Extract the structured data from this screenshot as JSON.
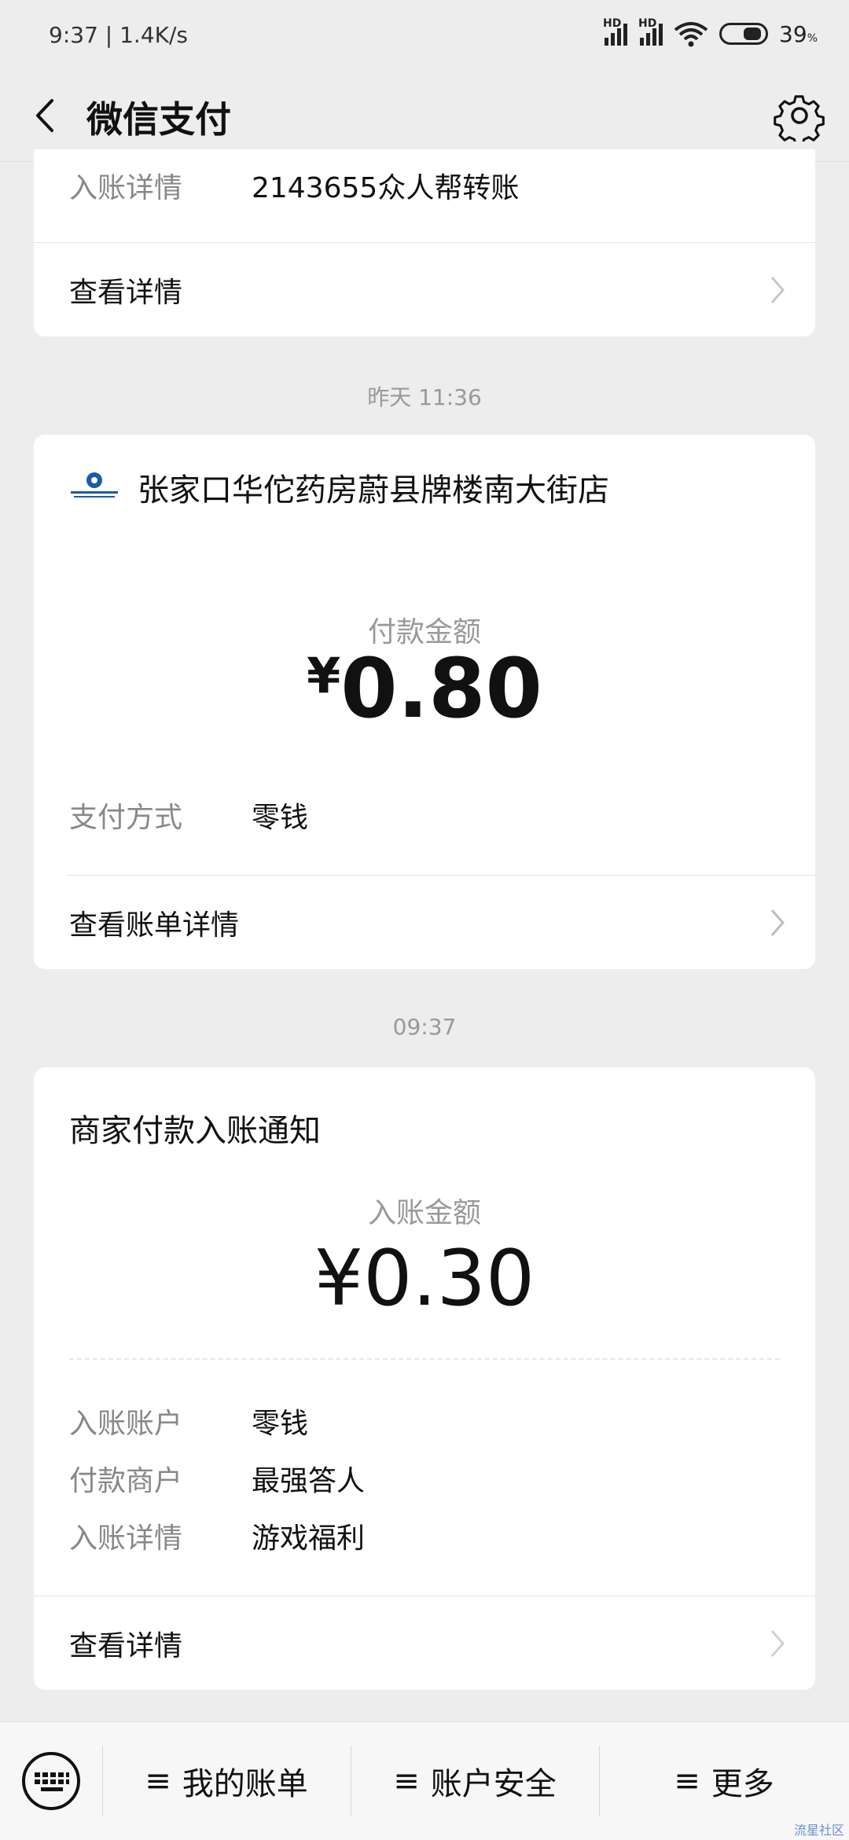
{
  "status": {
    "time": "9:37 | 1.4K/s",
    "network1": "HD",
    "network2": "HD",
    "battery": "39",
    "battery_unit": "%"
  },
  "nav": {
    "title": "微信支付"
  },
  "card1": {
    "label": "入账详情",
    "value": "2143655众人帮转账",
    "link": "查看详情"
  },
  "timestamp1": "昨天 11:36",
  "card2": {
    "merchant": "张家口华佗药房蔚县牌楼南大街店",
    "amount_label": "付款金额",
    "currency": "¥",
    "amount": "0.80",
    "pay_method_label": "支付方式",
    "pay_method_value": "零钱",
    "link": "查看账单详情"
  },
  "timestamp2": "09:37",
  "card3": {
    "title": "商家付款入账通知",
    "amount_label": "入账金额",
    "amount": "¥0.30",
    "rows": [
      {
        "label": "入账账户",
        "value": "零钱"
      },
      {
        "label": "付款商户",
        "value": "最强答人"
      },
      {
        "label": "入账详情",
        "value": "游戏福利"
      }
    ],
    "link": "查看详情"
  },
  "bottom": {
    "items": [
      "我的账单",
      "账户安全",
      "更多"
    ]
  },
  "watermark": "流星社区",
  "colors": {
    "background": "#ededed",
    "card": "#ffffff",
    "muted": "#999999"
  }
}
